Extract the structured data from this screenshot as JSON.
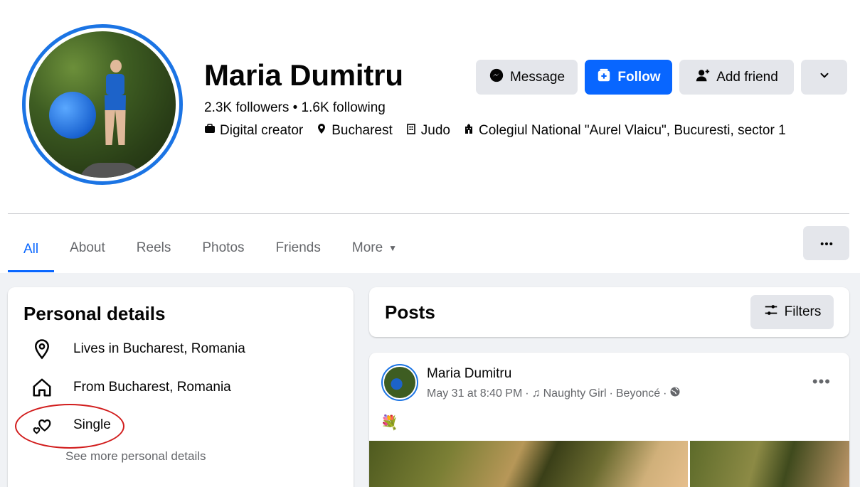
{
  "profile": {
    "name": "Maria Dumitru",
    "stats": "2.3K followers • 1.6K following",
    "details": [
      {
        "icon": "briefcase-icon",
        "text": "Digital creator"
      },
      {
        "icon": "location-pin-icon",
        "text": "Bucharest"
      },
      {
        "icon": "building-icon",
        "text": "Judo"
      },
      {
        "icon": "school-icon",
        "text": "Colegiul National \"Aurel Vlaicu\", Bucuresti, sector 1"
      }
    ]
  },
  "actions": {
    "message": "Message",
    "follow": "Follow",
    "add_friend": "Add friend"
  },
  "tabs": {
    "all": "All",
    "about": "About",
    "reels": "Reels",
    "photos": "Photos",
    "friends": "Friends",
    "more": "More"
  },
  "personal_details": {
    "title": "Personal details",
    "items": [
      {
        "icon": "location-pin-icon",
        "text": "Lives in Bucharest, Romania"
      },
      {
        "icon": "home-icon",
        "text": "From Bucharest, Romania"
      },
      {
        "icon": "hearts-icon",
        "text": "Single"
      }
    ],
    "see_more": "See more personal details"
  },
  "posts": {
    "title": "Posts",
    "filters": "Filters"
  },
  "post": {
    "author": "Maria Dumitru",
    "time": "May 31 at 8:40 PM",
    "sep1": "·",
    "song": "Naughty Girl",
    "sep2": "·",
    "artist": "Beyoncé",
    "sep3": "·",
    "emoji": "💐"
  },
  "colors": {
    "accent": "#0866ff",
    "annotation": "#d11b1b"
  }
}
